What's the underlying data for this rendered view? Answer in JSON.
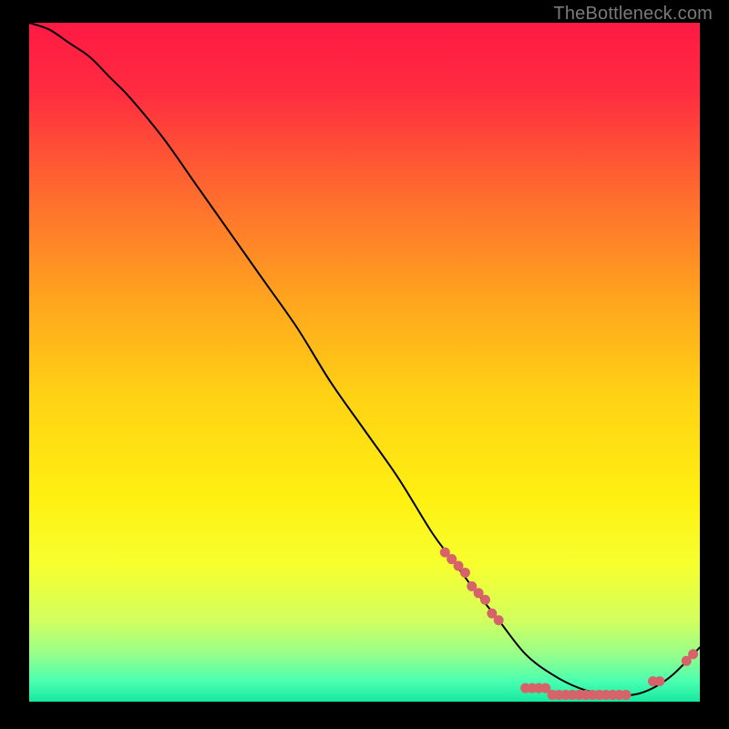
{
  "watermark": "TheBottleneck.com",
  "chart_data": {
    "type": "line",
    "title": "",
    "xlabel": "",
    "ylabel": "",
    "xlim": [
      0,
      100
    ],
    "ylim": [
      0,
      100
    ],
    "background_gradient": {
      "stops": [
        {
          "offset": 0.0,
          "color": "#ff1a44"
        },
        {
          "offset": 0.1,
          "color": "#ff2b40"
        },
        {
          "offset": 0.25,
          "color": "#ff6a2f"
        },
        {
          "offset": 0.4,
          "color": "#ffa21f"
        },
        {
          "offset": 0.55,
          "color": "#ffd214"
        },
        {
          "offset": 0.7,
          "color": "#fff011"
        },
        {
          "offset": 0.8,
          "color": "#f6ff2f"
        },
        {
          "offset": 0.88,
          "color": "#d2ff5e"
        },
        {
          "offset": 0.93,
          "color": "#97ff8a"
        },
        {
          "offset": 0.97,
          "color": "#4affb0"
        },
        {
          "offset": 1.0,
          "color": "#17e8a0"
        }
      ]
    },
    "series": [
      {
        "name": "curve",
        "type": "line",
        "x": [
          0,
          3,
          6,
          9,
          12,
          15,
          20,
          25,
          30,
          35,
          40,
          45,
          50,
          55,
          60,
          63,
          66,
          70,
          74,
          78,
          82,
          86,
          90,
          93,
          96,
          100
        ],
        "y": [
          100,
          99,
          97,
          95,
          92,
          89,
          83,
          76,
          69,
          62,
          55,
          47,
          40,
          33,
          25,
          21,
          17,
          12,
          7,
          4,
          2,
          1,
          1,
          2,
          4,
          8
        ]
      },
      {
        "name": "markers",
        "type": "scatter",
        "x": [
          62,
          63,
          64,
          65,
          66,
          67,
          68,
          69,
          70,
          74,
          75,
          76,
          77,
          78,
          79,
          80,
          81,
          82,
          83,
          84,
          85,
          86,
          87,
          88,
          89,
          93,
          94,
          98,
          99
        ],
        "y": [
          22,
          21,
          20,
          19,
          17,
          16,
          15,
          13,
          12,
          2,
          2,
          2,
          2,
          1,
          1,
          1,
          1,
          1,
          1,
          1,
          1,
          1,
          1,
          1,
          1,
          3,
          3,
          6,
          7
        ]
      }
    ]
  }
}
